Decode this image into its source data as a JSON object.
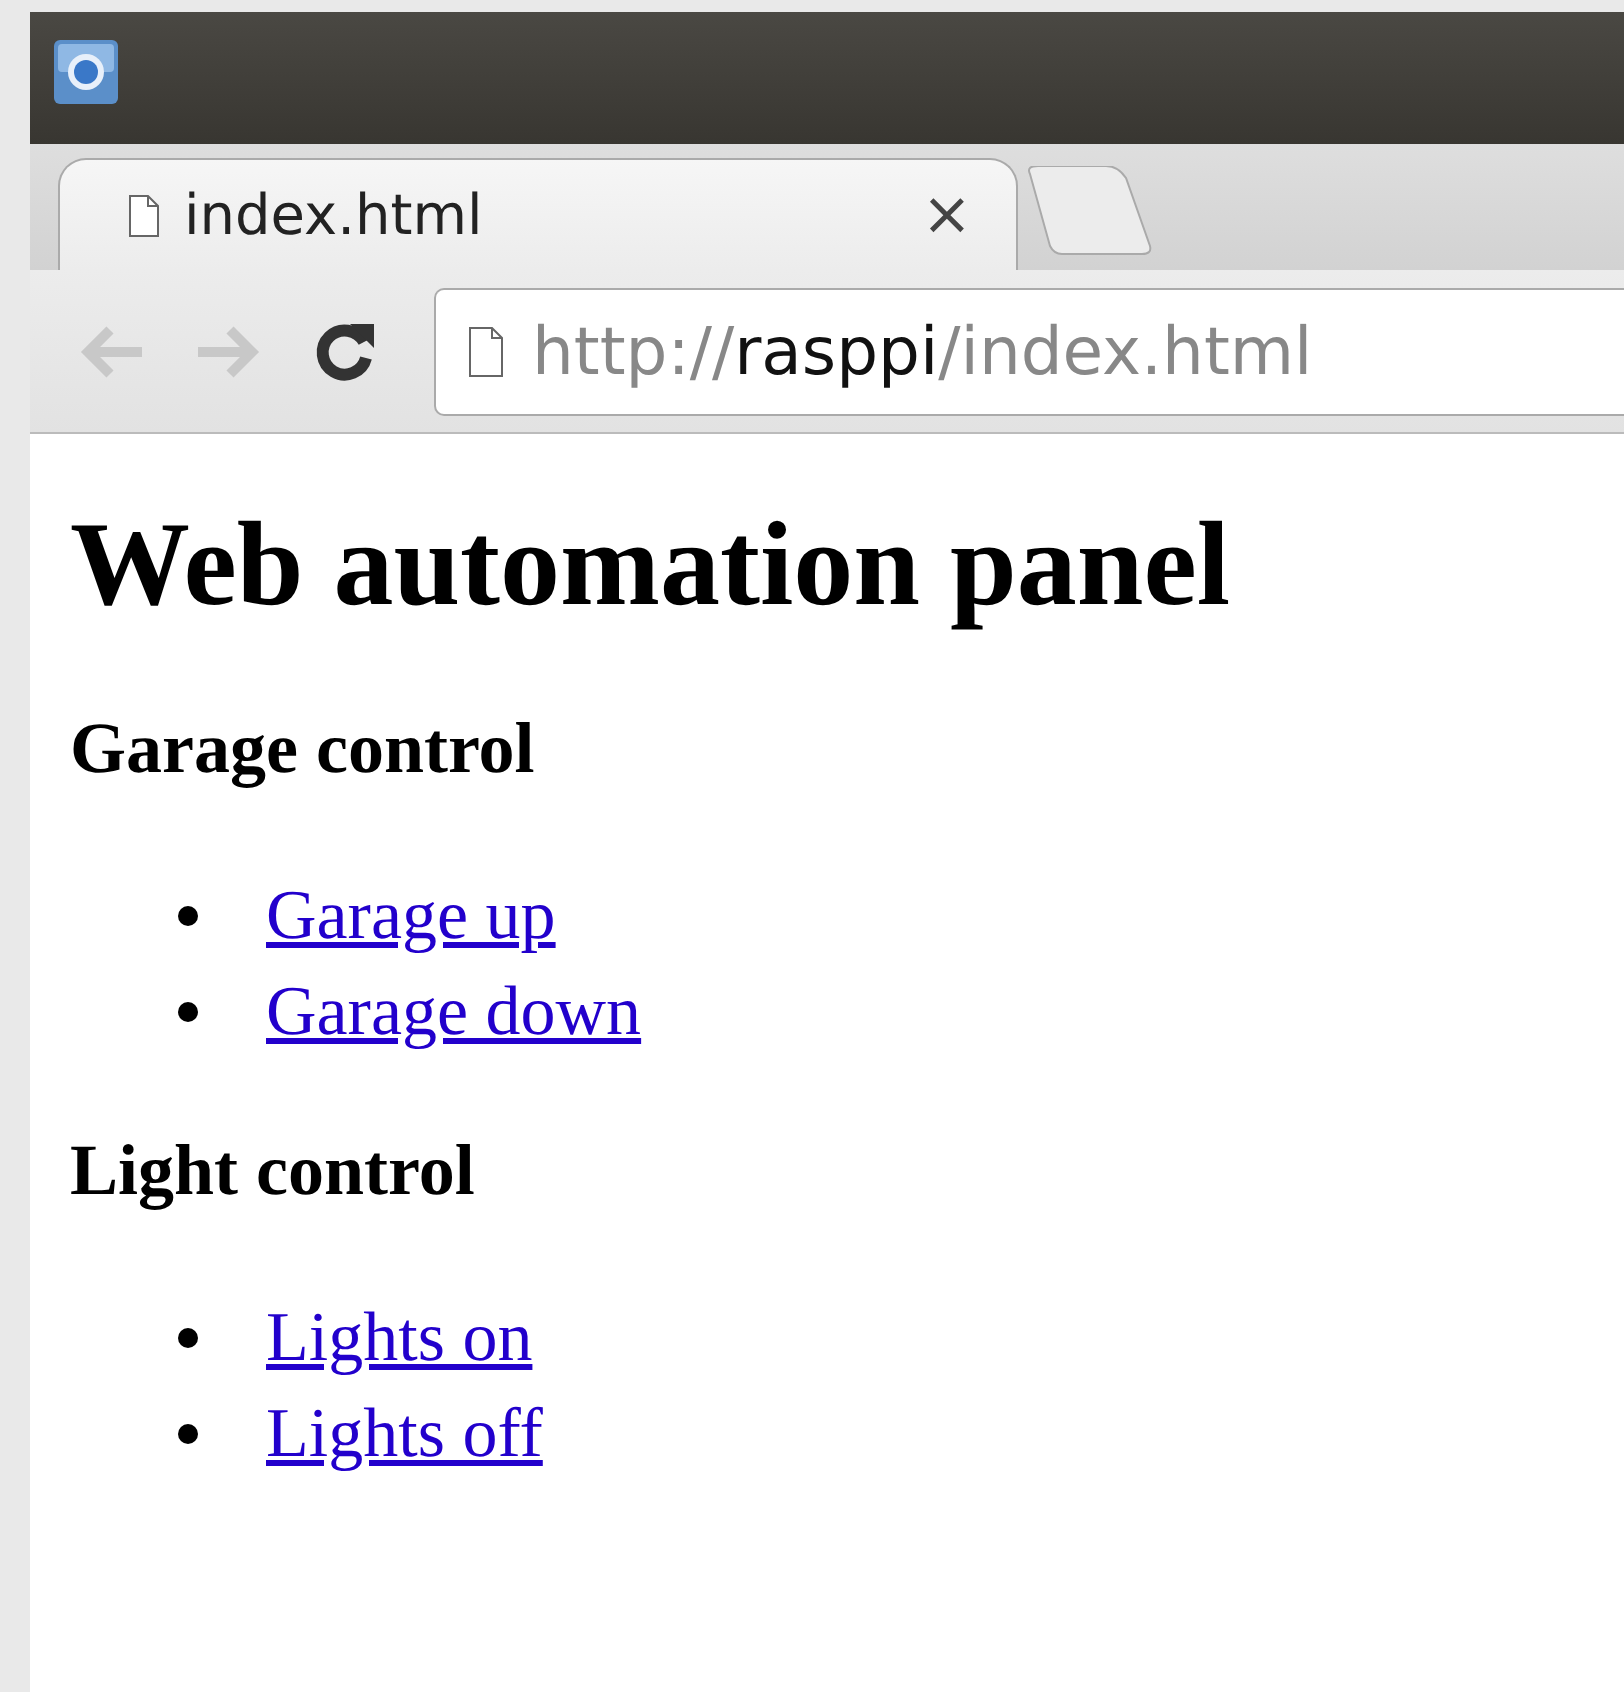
{
  "browser": {
    "tab": {
      "title": "index.html",
      "close": "×"
    },
    "nav": {
      "back": {
        "disabled": true
      },
      "forward": {
        "disabled": true
      }
    },
    "address": {
      "scheme": "http://",
      "host": "rasppi",
      "path": "/index.html"
    }
  },
  "page": {
    "title": "Web automation panel",
    "sections": [
      {
        "heading": "Garage control",
        "links": [
          "Garage up",
          "Garage down"
        ]
      },
      {
        "heading": "Light control",
        "links": [
          "Lights on",
          "Lights off"
        ]
      }
    ]
  }
}
